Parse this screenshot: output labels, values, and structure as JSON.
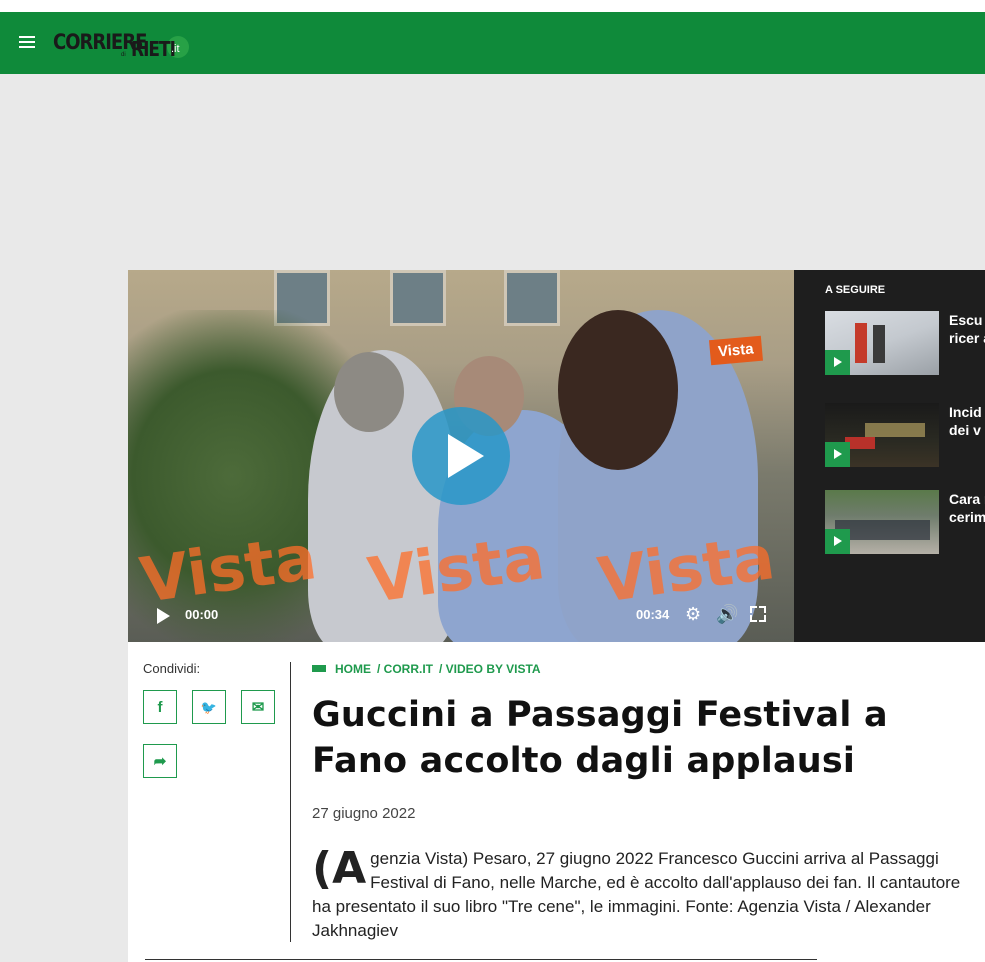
{
  "header": {
    "logo": {
      "word1": "CORRIERE",
      "word2": "RIETI",
      "small": "di",
      "tld": ".it"
    },
    "brand_color": "#0f8a3a"
  },
  "video": {
    "watermark": "Vista",
    "channel_logo": "Vista",
    "time_current": "00:00",
    "time_total": "00:34"
  },
  "up_next": {
    "title": "A SEGUIRE",
    "items": [
      {
        "label": "Escu sui M ricer alpin"
      },
      {
        "label": "Incid pers dei v"
      },
      {
        "label": "Cara milit cerim"
      }
    ]
  },
  "share": {
    "label": "Condividi:",
    "buttons": [
      {
        "icon": "facebook-icon",
        "glyph": "f"
      },
      {
        "icon": "twitter-icon",
        "glyph": "🐦"
      },
      {
        "icon": "email-icon",
        "glyph": "✉"
      },
      {
        "icon": "share-icon",
        "glyph": "➦"
      }
    ]
  },
  "breadcrumb": {
    "home": "HOME",
    "section": "/ CORR.IT",
    "subsection": "/ VIDEO BY VISTA"
  },
  "article": {
    "title": "Guccini a Passaggi Festival a Fano accolto dagli applausi",
    "date": "27 giugno 2022",
    "drop_cap": "(A",
    "body": "genzia Vista) Pesaro, 27 giugno 2022 Francesco Guccini arriva al Passaggi Festival di Fano, nelle Marche, ed è accolto dall'applauso dei fan. Il cantautore ha presentato il suo libro \"Tre cene\", le immagini. Fonte: Agenzia Vista / Alexander Jakhnagiev"
  }
}
